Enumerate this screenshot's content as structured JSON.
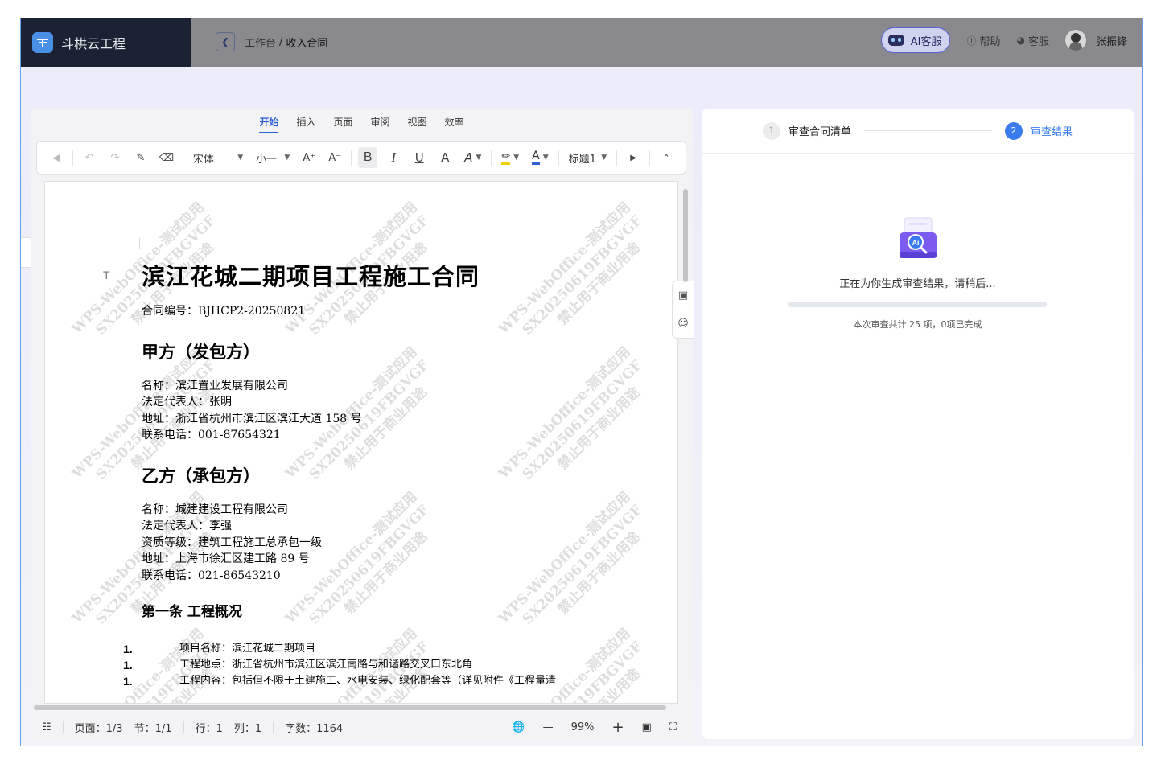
{
  "header": {
    "brand": "斗栱云工程",
    "breadcrumb_parent": "工作台",
    "breadcrumb_sep": "/",
    "breadcrumb_current": "收入合同",
    "ai_service": "AI客服",
    "help": "帮助",
    "service": "客服",
    "user_name": "张振锋"
  },
  "editor": {
    "tabs": [
      "开始",
      "插入",
      "页面",
      "审阅",
      "视图",
      "效率"
    ],
    "active_tab": "开始",
    "toolbar": {
      "font_family": "宋体",
      "font_size": "小一",
      "grow": "A⁺",
      "shrink": "A⁻",
      "bold": "B",
      "italic": "I",
      "underline": "U",
      "strike": "A",
      "text_effect": "A",
      "font_color": "A",
      "style": "标题1"
    },
    "watermark": {
      "line1": "WPS-WebOffice-测试应用",
      "line2": "SX20250619FBGVGF",
      "line3": "禁止用于商业用途"
    },
    "doc": {
      "title": "滨江花城二期项目工程施工合同",
      "contract_no": "合同编号：BJHCP2-20250821",
      "party_a_heading": "甲方（发包方）",
      "party_a": [
        "名称：滨江置业发展有限公司",
        "法定代表人：张明",
        "地址：浙江省杭州市滨江区滨江大道 158 号",
        "联系电话：001-87654321"
      ],
      "party_b_heading": "乙方（承包方）",
      "party_b": [
        "名称：城建建设工程有限公司",
        "法定代表人：李强",
        "资质等级：建筑工程施工总承包一级",
        "地址：上海市徐汇区建工路 89 号",
        "联系电话：021-86543210"
      ],
      "article1_heading": "第一条 工程概况",
      "article1_items": [
        {
          "num": "1.",
          "text": "项目名称：滨江花城二期项目"
        },
        {
          "num": "1.",
          "text": "工程地点：浙江省杭州市滨江区滨江南路与和谐路交叉口东北角"
        },
        {
          "num": "1.",
          "text": "工程内容：包括但不限于土建施工、水电安装、绿化配套等（详见附件《工程量清"
        }
      ]
    },
    "status": {
      "page": "页面：1/3",
      "section": "节：1/1",
      "row": "行：1",
      "col": "列：1",
      "words": "字数：1164",
      "zoom": "99%"
    }
  },
  "review": {
    "step1_num": "1",
    "step1_label": "审查合同清单",
    "step2_num": "2",
    "step2_label": "审查结果",
    "generating": "正在为你生成审查结果，请稍后...",
    "progress_fraction": 0,
    "count_text": "本次审查共计 25 项，0项已完成"
  }
}
